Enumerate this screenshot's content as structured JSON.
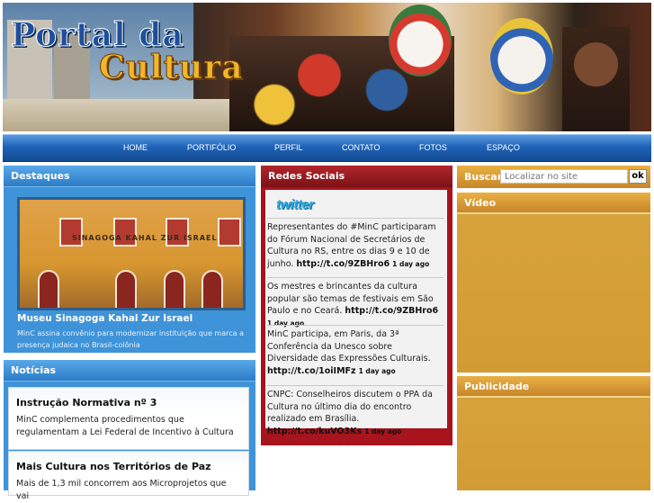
{
  "header": {
    "logo_line1": "Portal da",
    "logo_line2": "Cultura"
  },
  "nav": {
    "items": [
      {
        "label": "HOME"
      },
      {
        "label": "PORTIFÓLIO"
      },
      {
        "label": "PERFIL"
      },
      {
        "label": "CONTATO"
      },
      {
        "label": "FOTOS"
      },
      {
        "label": "ESPAÇO"
      }
    ]
  },
  "destaques": {
    "heading": "Destaques",
    "photo_sign": "SINAGOGA KAHAL ZUR ISRAEL",
    "title": "Museu Sinagoga Kahal Zur Israel",
    "description": "MinC assina convênio para modernizar instituição que marca a presença judaica no Brasil-colônia"
  },
  "noticias": {
    "heading": "Notícias",
    "items": [
      {
        "title": "Instrução Normativa nº 3",
        "text": "MinC complementa procedimentos que regulamentam a Lei Federal de Incentivo à Cultura"
      },
      {
        "title": "Mais Cultura nos Territórios de Paz",
        "text": "Mais de 1,3 mil concorrem aos Microprojetos que vai"
      }
    ]
  },
  "redes": {
    "heading": "Redes Sociais",
    "twitter_logo": "twitter",
    "tweets": [
      {
        "text": "Representantes do #MinC participaram do Fórum Nacional de Secretários de Cultura no RS, entre os dias 9 e 10 de junho.",
        "link": "http://t.co/9ZBHro6",
        "ago": "1 day ago"
      },
      {
        "text": "Os mestres e brincantes da cultura popular são temas de festivais em São Paulo e no Ceará.",
        "link": "http://t.co/9ZBHro6",
        "ago": "1 day ago"
      },
      {
        "text": "MinC participa, em Paris, da 3ª Conferência da Unesco sobre Diversidade das Expressões Culturais.",
        "link": "http://t.co/1oiIMFz",
        "ago": "1 day ago"
      },
      {
        "text": "CNPC: Conselheiros discutem o PPA da Cultura no último dia do encontro realizado em Brasília.",
        "link": "http://t.co/kuVO3Ks",
        "ago": "1 day ago"
      }
    ]
  },
  "busca": {
    "label": "Buscar",
    "placeholder": "Localizar no site",
    "button": "ok"
  },
  "video": {
    "heading": "Vídeo"
  },
  "publicidade": {
    "heading": "Publicidade"
  }
}
